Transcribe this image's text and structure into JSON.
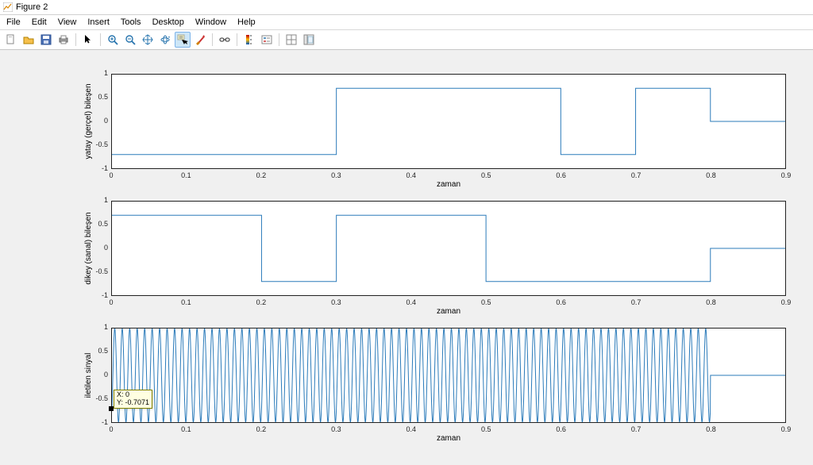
{
  "window": {
    "title": "Figure 2"
  },
  "menu": {
    "items": [
      "File",
      "Edit",
      "View",
      "Insert",
      "Tools",
      "Desktop",
      "Window",
      "Help"
    ]
  },
  "toolbar": {
    "icons": [
      "new-figure-icon",
      "open-icon",
      "save-icon",
      "print-icon",
      "sep",
      "pointer-icon",
      "sep",
      "zoom-in-icon",
      "zoom-out-icon",
      "pan-icon",
      "rotate3d-icon",
      "data-cursor-icon",
      "brush-icon",
      "sep",
      "link-icon",
      "sep",
      "colorbar-icon",
      "legend-icon",
      "sep",
      "subplot-icon",
      "plot-tools-icon"
    ],
    "active": "data-cursor-icon"
  },
  "datatip": {
    "x_label": "X: 0",
    "y_label": "Y: -0.7071"
  },
  "chart_data": [
    {
      "type": "line",
      "ylabel": "yatay (gerçel) bileşen",
      "xlabel": "zaman",
      "xlim": [
        0,
        0.9
      ],
      "ylim": [
        -1,
        1
      ],
      "xticks": [
        0,
        0.1,
        0.2,
        0.3,
        0.4,
        0.5,
        0.6,
        0.7,
        0.8,
        0.9
      ],
      "yticks": [
        -1,
        -0.5,
        0,
        0.5,
        1
      ],
      "step_segments": [
        {
          "x0": 0.0,
          "x1": 0.3,
          "y": -0.7071
        },
        {
          "x0": 0.3,
          "x1": 0.6,
          "y": 0.7071
        },
        {
          "x0": 0.6,
          "x1": 0.7,
          "y": -0.7071
        },
        {
          "x0": 0.7,
          "x1": 0.8,
          "y": 0.7071
        },
        {
          "x0": 0.8,
          "x1": 0.9,
          "y": 0.0
        }
      ]
    },
    {
      "type": "line",
      "ylabel": "dikey (sanal) bileşen",
      "xlabel": "zaman",
      "xlim": [
        0,
        0.9
      ],
      "ylim": [
        -1,
        1
      ],
      "xticks": [
        0,
        0.1,
        0.2,
        0.3,
        0.4,
        0.5,
        0.6,
        0.7,
        0.8,
        0.9
      ],
      "yticks": [
        -1,
        -0.5,
        0,
        0.5,
        1
      ],
      "step_segments": [
        {
          "x0": 0.0,
          "x1": 0.2,
          "y": 0.7071
        },
        {
          "x0": 0.2,
          "x1": 0.3,
          "y": -0.7071
        },
        {
          "x0": 0.3,
          "x1": 0.5,
          "y": 0.7071
        },
        {
          "x0": 0.5,
          "x1": 0.8,
          "y": -0.7071
        },
        {
          "x0": 0.8,
          "x1": 0.9,
          "y": 0.0
        }
      ]
    },
    {
      "type": "line",
      "ylabel": "iletilen sinyal",
      "xlabel": "zaman",
      "xlim": [
        0,
        0.9
      ],
      "ylim": [
        -1,
        1
      ],
      "xticks": [
        0,
        0.1,
        0.2,
        0.3,
        0.4,
        0.5,
        0.6,
        0.7,
        0.8,
        0.9
      ],
      "yticks": [
        -1,
        -0.5,
        0,
        0.5,
        1
      ],
      "carrier": {
        "freq_hz": 100,
        "amplitude_segments": [
          {
            "x0": 0.0,
            "x1": 0.8,
            "amp": 1.0
          },
          {
            "x0": 0.8,
            "x1": 0.9,
            "amp": 0.0
          }
        ],
        "initial_y": -0.7071
      }
    }
  ]
}
